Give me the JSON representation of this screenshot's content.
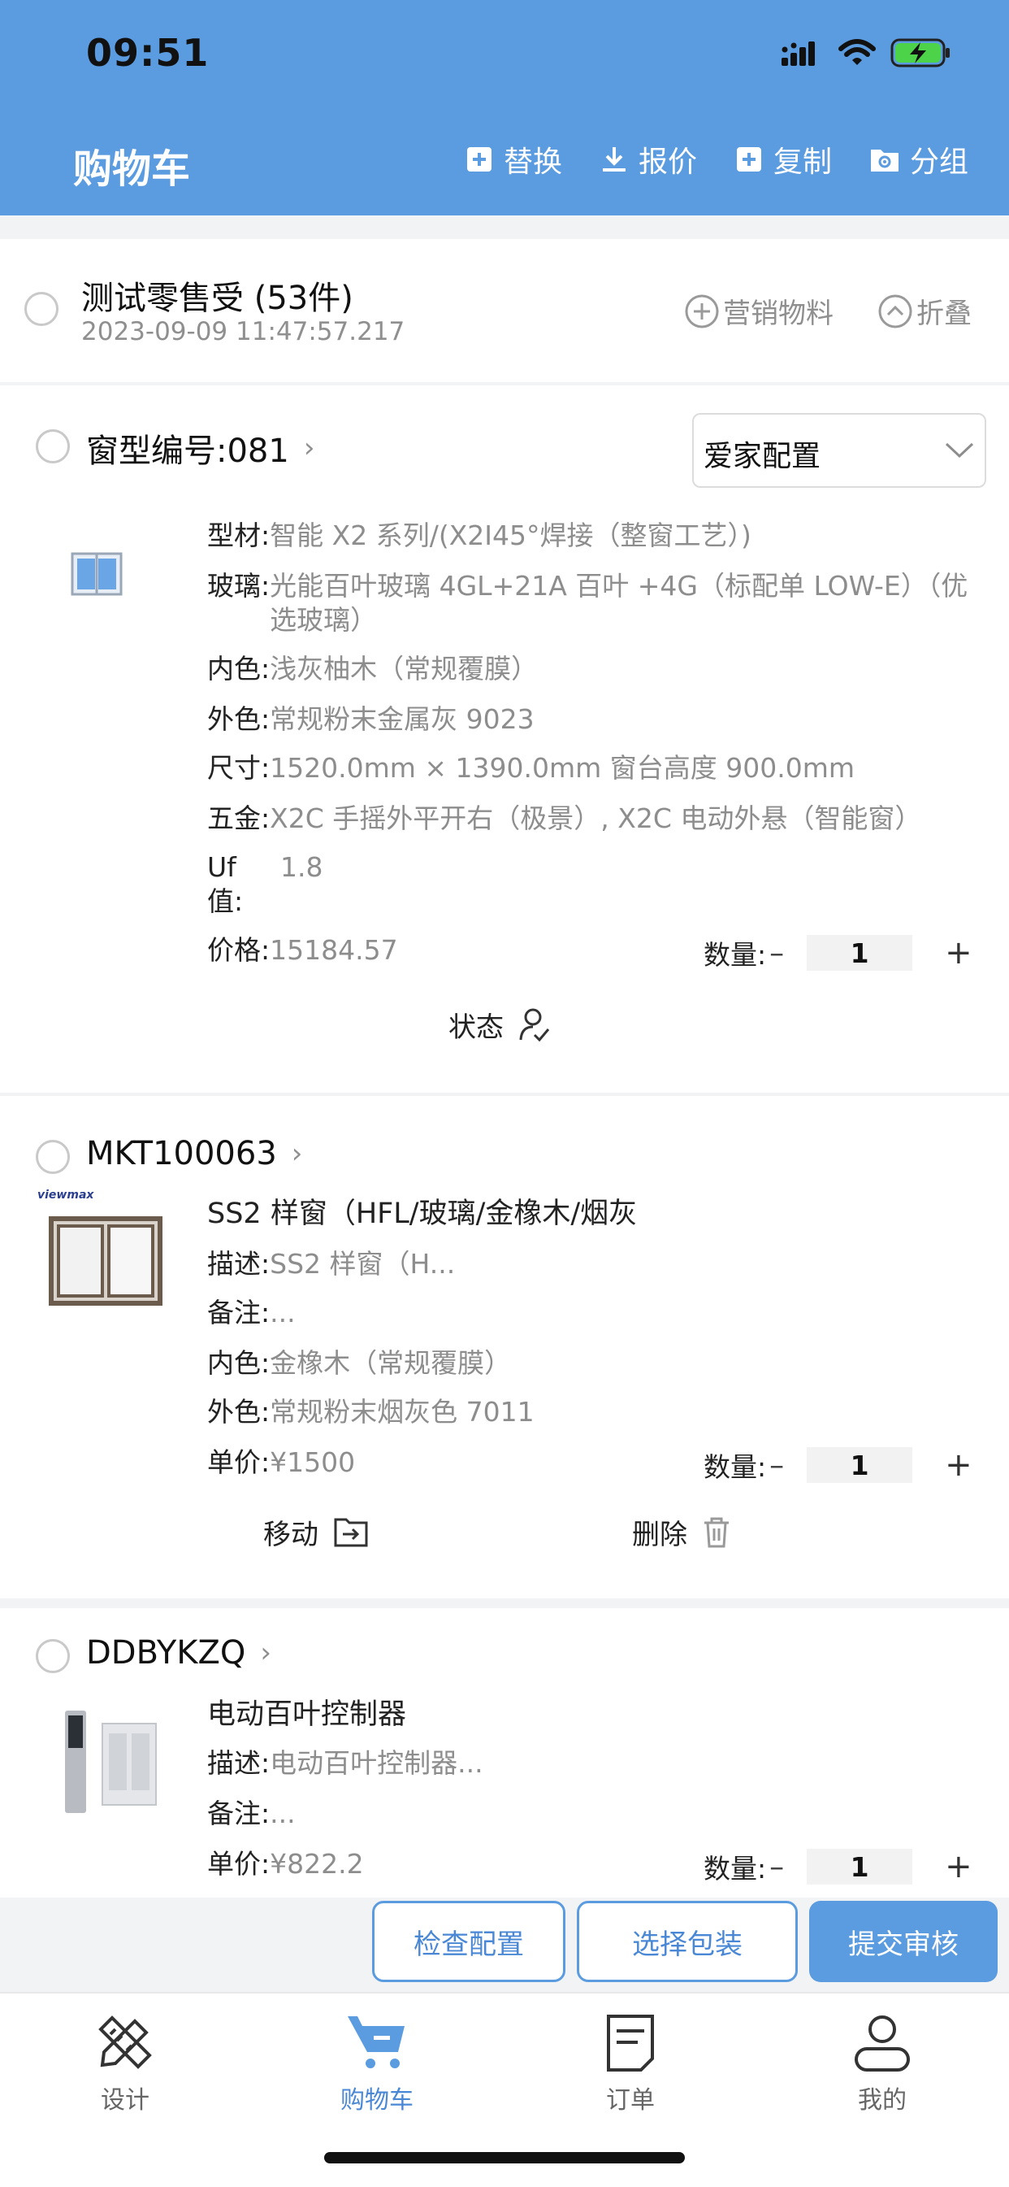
{
  "status_bar": {
    "time": "09:51"
  },
  "header": {
    "title": "购物车",
    "actions": [
      {
        "label": "替换",
        "icon": "replace-icon"
      },
      {
        "label": "报价",
        "icon": "download-icon"
      },
      {
        "label": "复制",
        "icon": "copy-icon"
      },
      {
        "label": "分组",
        "icon": "folder-gear-icon"
      }
    ]
  },
  "customer": {
    "name": "测试零售受 (53件)",
    "datetime": "2023-09-09 11:47:57.217",
    "marketing_label": "营销物料",
    "collapse_label": "折叠"
  },
  "items": [
    {
      "title": "窗型编号:081",
      "config_select": "爱家配置",
      "attrs": [
        {
          "k": "型材:",
          "v": "智能 X2 系列/(X2I45°焊接（整窗工艺）)"
        },
        {
          "k": "玻璃:",
          "v": "光能百叶玻璃 4GL+21A 百叶 +4G（标配单 LOW-E）（优选玻璃）"
        },
        {
          "k": "内色:",
          "v": "浅灰柚木（常规覆膜）"
        },
        {
          "k": "外色:",
          "v": "常规粉末金属灰 9023"
        },
        {
          "k": "尺寸:",
          "v": "1520.0mm × 1390.0mm 窗台高度 900.0mm"
        },
        {
          "k": "五金:",
          "v": "X2C 手摇外平开右（极景）, X2C 电动外悬（智能窗）"
        },
        {
          "k": "Uf 值:",
          "v": "1.8"
        },
        {
          "k": "价格:",
          "v": "15184.57"
        }
      ],
      "qty_label": "数量:",
      "qty": "1",
      "status_label": "状态"
    },
    {
      "title": "MKT100063",
      "brand": "viewmax",
      "name": "SS2 样窗（HFL/玻璃/金橡木/烟灰",
      "attrs": [
        {
          "k": "描述:",
          "v": "SS2 样窗（H..."
        },
        {
          "k": "备注:",
          "v": "..."
        },
        {
          "k": "内色:",
          "v": "金橡木（常规覆膜）"
        },
        {
          "k": "外色:",
          "v": "常规粉末烟灰色 7011"
        },
        {
          "k": "单价:",
          "v": "¥1500"
        }
      ],
      "qty_label": "数量:",
      "qty": "1",
      "move_label": "移动",
      "delete_label": "删除"
    },
    {
      "title": "DDBYKZQ",
      "name": "电动百叶控制器",
      "attrs": [
        {
          "k": "描述:",
          "v": "电动百叶控制器..."
        },
        {
          "k": "备注:",
          "v": "..."
        },
        {
          "k": "单价:",
          "v": "¥822.2"
        }
      ],
      "qty_label": "数量:",
      "qty": "1"
    }
  ],
  "footer_buttons": {
    "check": "检查配置",
    "package": "选择包装",
    "submit": "提交审核"
  },
  "tabbar": [
    {
      "label": "设计",
      "icon": "design-tools-icon"
    },
    {
      "label": "购物车",
      "icon": "cart-icon",
      "active": true
    },
    {
      "label": "订单",
      "icon": "order-doc-icon"
    },
    {
      "label": "我的",
      "icon": "user-icon"
    }
  ],
  "colors": {
    "primary": "#5b9be0",
    "active_text": "#4a88d6"
  }
}
